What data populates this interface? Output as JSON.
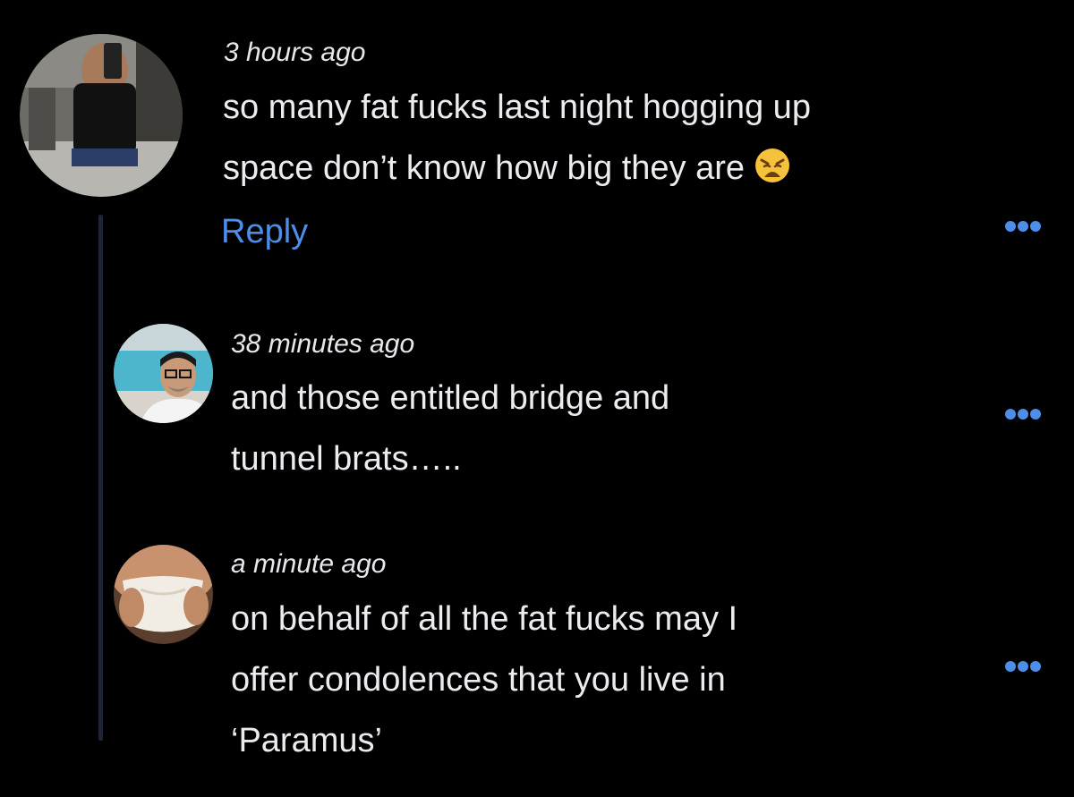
{
  "thread": {
    "comments": [
      {
        "timestamp": "3 hours ago",
        "lines": [
          "so many fat fucks last night hogging up",
          "space don’t know how big they are"
        ],
        "emoji_icon": "weary-face-emoji-icon",
        "reply_label": "Reply",
        "more_icon": "more-options-icon"
      },
      {
        "timestamp": "38 minutes ago",
        "lines": [
          "and those entitled bridge and",
          "tunnel brats….."
        ],
        "more_icon": "more-options-icon"
      },
      {
        "timestamp": "a minute ago",
        "lines": [
          "on behalf of all the fat fucks may I",
          "offer condolences that you live in",
          "‘Paramus’"
        ],
        "more_icon": "more-options-icon"
      }
    ]
  },
  "colors": {
    "background": "#000000",
    "text": "#ececf0",
    "link": "#4d8fe8",
    "thread_line": "#1f2534"
  }
}
